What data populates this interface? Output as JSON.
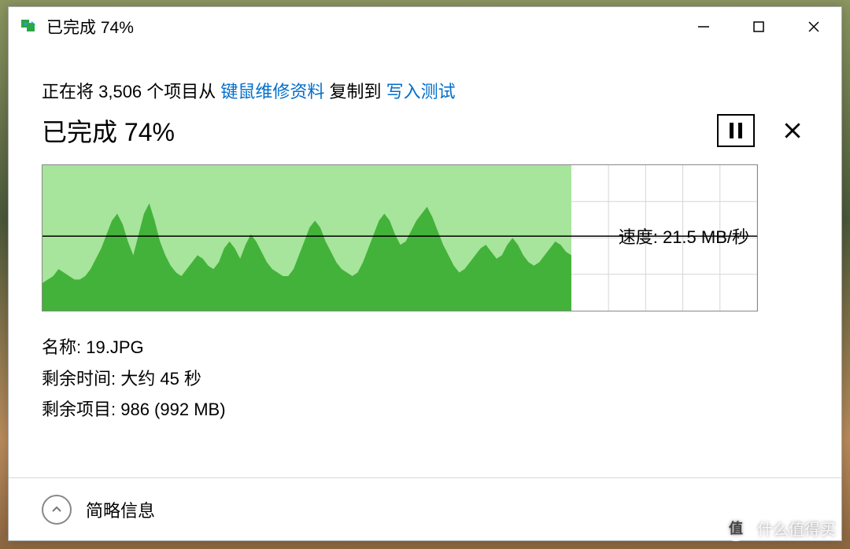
{
  "window": {
    "title": "已完成 74%"
  },
  "operation": {
    "prefix": "正在将 3,506 个项目从 ",
    "source": "键鼠维修资料",
    "middle": " 复制到 ",
    "destination": "写入测试"
  },
  "progress": {
    "label": "已完成 74%",
    "percent": 74
  },
  "speed": {
    "prefix": "速度: ",
    "value": "21.5 MB/秒"
  },
  "details": {
    "name_label": "名称: ",
    "name_value": "19.JPG",
    "time_label": "剩余时间: ",
    "time_value": "大约 45 秒",
    "items_label": "剩余项目: ",
    "items_value": "986 (992 MB)"
  },
  "footer": {
    "toggle": "简略信息"
  },
  "watermark": {
    "badge": "值",
    "text": "什么值得买"
  },
  "chart_data": {
    "type": "area",
    "ylabel": "传输速度 (MB/秒)",
    "ylim": [
      0,
      42
    ],
    "progress_fraction": 0.74,
    "current_speed": 21.5,
    "values": [
      8,
      9,
      10,
      12,
      11,
      10,
      9,
      9,
      10,
      12,
      15,
      18,
      22,
      26,
      28,
      25,
      20,
      16,
      22,
      28,
      31,
      26,
      20,
      16,
      13,
      11,
      10,
      12,
      14,
      16,
      15,
      13,
      12,
      14,
      18,
      20,
      18,
      15,
      19,
      22,
      20,
      17,
      14,
      12,
      11,
      10,
      10,
      12,
      16,
      20,
      24,
      26,
      24,
      20,
      17,
      14,
      12,
      11,
      10,
      11,
      14,
      18,
      22,
      26,
      28,
      26,
      22,
      19,
      20,
      23,
      26,
      28,
      30,
      27,
      23,
      19,
      16,
      13,
      11,
      12,
      14,
      16,
      18,
      19,
      17,
      15,
      16,
      19,
      21,
      19,
      16,
      14,
      13,
      14,
      16,
      18,
      20,
      19,
      17,
      16
    ]
  },
  "colors": {
    "fill_done_light": "#a6e59b",
    "fill_done_dark": "#43b23a",
    "grid": "#d6d6d6",
    "baseline": "#000000",
    "link": "#006ecc"
  }
}
